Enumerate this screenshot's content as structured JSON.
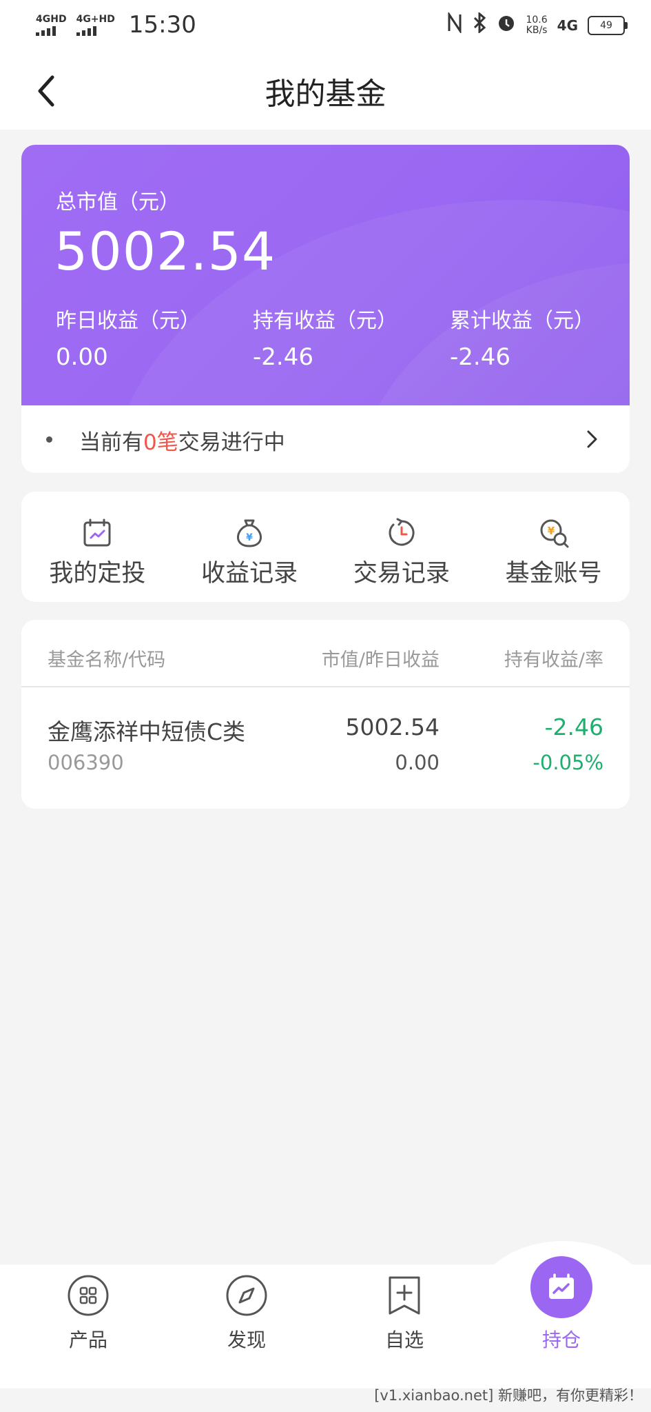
{
  "status_bar": {
    "sim1": "4GHD",
    "sim2": "4G+HD",
    "time": "15:30",
    "speed_value": "10.6",
    "speed_unit": "KB/s",
    "network": "4G",
    "battery": "49"
  },
  "header": {
    "title": "我的基金"
  },
  "summary": {
    "total_label": "总市值（元）",
    "total_value": "5002.54",
    "yesterday_label": "昨日收益（元）",
    "yesterday_value": "0.00",
    "holding_label": "持有收益（元）",
    "holding_value": "-2.46",
    "cumulative_label": "累计收益（元）",
    "cumulative_value": "-2.46"
  },
  "pending": {
    "prefix": "当前有",
    "count": "0笔",
    "suffix": "交易进行中"
  },
  "actions": [
    {
      "label": "我的定投",
      "icon": "calendar-chart-icon"
    },
    {
      "label": "收益记录",
      "icon": "money-bag-icon"
    },
    {
      "label": "交易记录",
      "icon": "clock-history-icon"
    },
    {
      "label": "基金账号",
      "icon": "coin-search-icon"
    }
  ],
  "table": {
    "headers": [
      "基金名称/代码",
      "市值/昨日收益",
      "持有收益/率"
    ],
    "rows": [
      {
        "name": "金鹰添祥中短债C类",
        "code": "006390",
        "market_value": "5002.54",
        "yesterday": "0.00",
        "holding_profit": "-2.46",
        "holding_rate": "-0.05%"
      }
    ]
  },
  "tabs": [
    {
      "label": "产品",
      "icon": "grid-icon"
    },
    {
      "label": "发现",
      "icon": "compass-icon"
    },
    {
      "label": "自选",
      "icon": "bookmark-plus-icon"
    },
    {
      "label": "持仓",
      "icon": "holdings-chart-icon",
      "active": true
    }
  ],
  "footer": {
    "note": "[v1.xianbao.net] 新赚吧，有你更精彩！"
  },
  "colors": {
    "accent": "#9a66f2",
    "positive_red": "#f2554a",
    "negative_green": "#1fae6e"
  }
}
